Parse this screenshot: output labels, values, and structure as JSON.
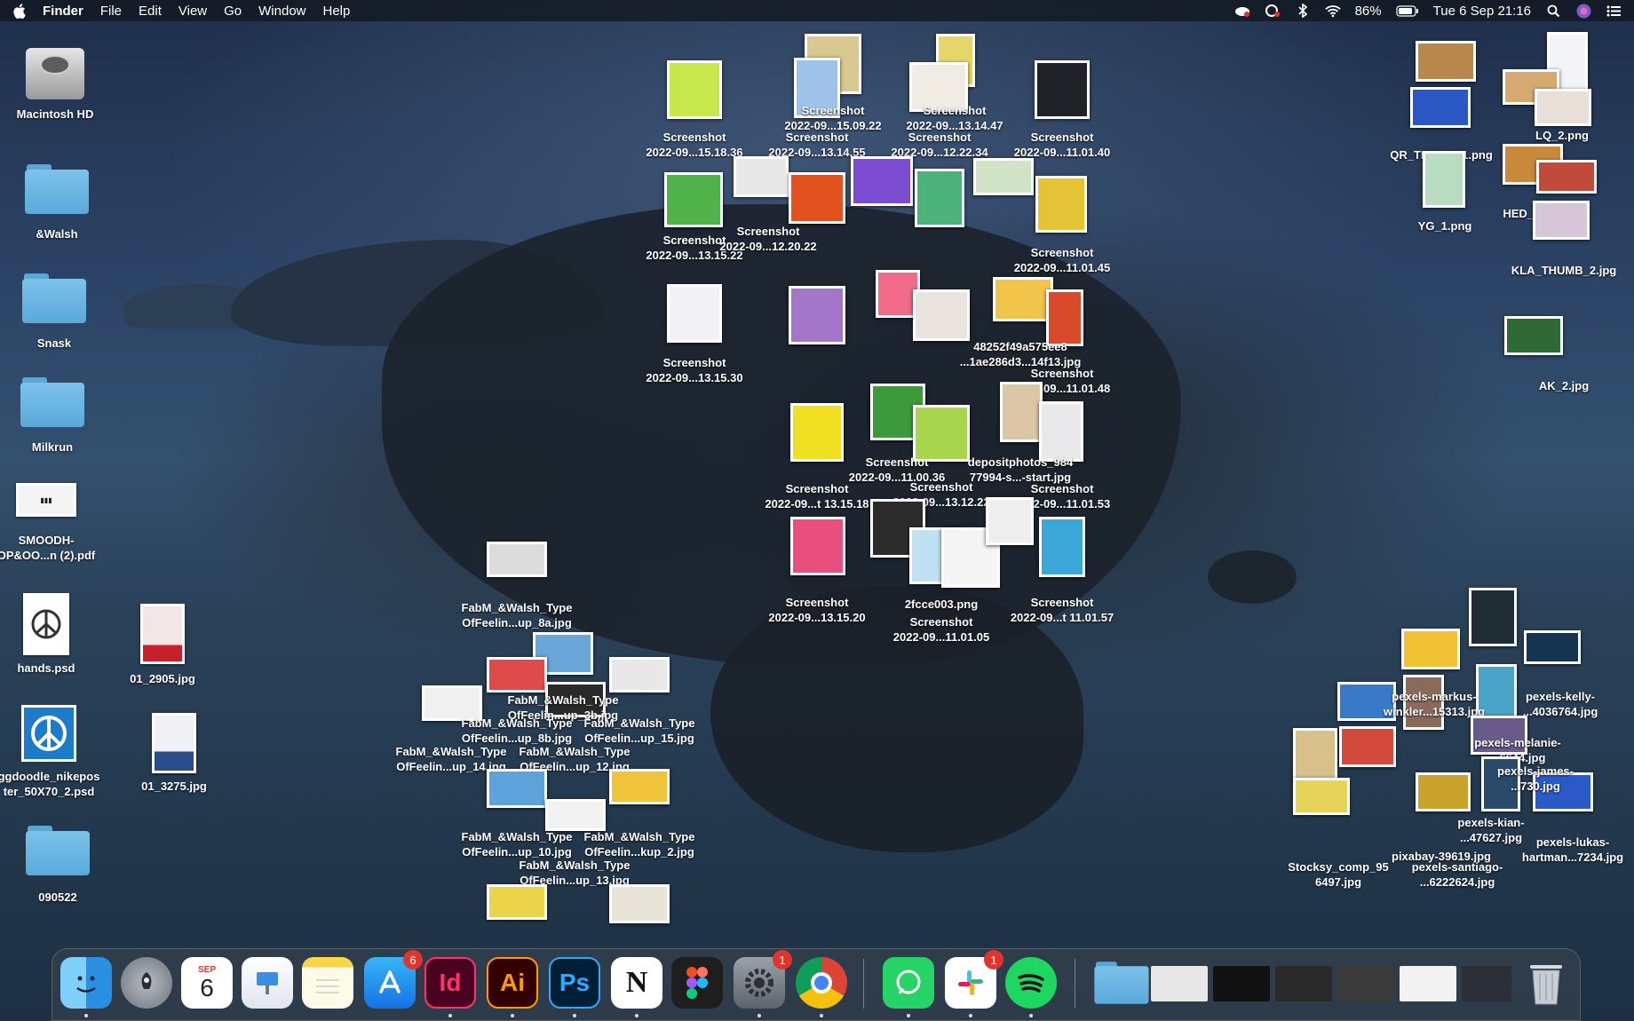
{
  "menubar": {
    "app": "Finder",
    "items": [
      "File",
      "Edit",
      "View",
      "Go",
      "Window",
      "Help"
    ],
    "battery": "86%",
    "datetime": "Tue 6 Sep  21:16"
  },
  "desktop_left": [
    {
      "label": "Macintosh HD"
    },
    {
      "label": "&Walsh"
    },
    {
      "label": "Snask"
    },
    {
      "label": "Milkrun"
    },
    {
      "label": "SMOODH-\nOP&OO...n (2).pdf"
    },
    {
      "label": "hands.psd"
    },
    {
      "label": "01_2905.jpg"
    },
    {
      "label": "ggdoodle_nikepos\nter_50X70_2.psd"
    },
    {
      "label": "01_3275.jpg"
    },
    {
      "label": "090522"
    }
  ],
  "screenshots": [
    {
      "label": "Screenshot\n2022-09...15.18.36"
    },
    {
      "label": "Screenshot\n2022-09...15.09.22"
    },
    {
      "label": "Screenshot\n2022-09...13.14.55"
    },
    {
      "label": "Screenshot\n2022-09...13.14.47"
    },
    {
      "label": "Screenshot\n2022-09...12.22.34"
    },
    {
      "label": "Screenshot\n2022-09...11.01.40"
    },
    {
      "label": "Screenshot\n2022-09...13.15.22"
    },
    {
      "label": "Screenshot\n2022-09...12.20.22"
    },
    {
      "label": "Screenshot\n2022-09...11.01.45"
    },
    {
      "label": "Screenshot\n2022-09...13.15.30"
    },
    {
      "label": "Screenshot\n2022-09...11.01.48"
    },
    {
      "label": "48252f49a575ee8\n...1ae286d3...14f13.jpg"
    },
    {
      "label": "Screenshot\n2022-09...t 13.15.18"
    },
    {
      "label": "Screenshot\n2022-09...11.00.36"
    },
    {
      "label": "Screenshot\n2022-09...13.12.22"
    },
    {
      "label": "depositphotos_984\n77994-s...-start.jpg"
    },
    {
      "label": "Screenshot\n2022-09...11.01.53"
    },
    {
      "label": "Screenshot\n2022-09...13.15.20"
    },
    {
      "label": "2fcce003.png"
    },
    {
      "label": "Screenshot\n2022-09...11.01.05"
    },
    {
      "label": "Screenshot\n2022-09...t 11.01.57"
    }
  ],
  "fabm": [
    {
      "label": "FabM_&Walsh_Type\nOfFeelin...up_8a.jpg"
    },
    {
      "label": "FabM_&Walsh_Type\nOfFeelin...up_3b.jpg"
    },
    {
      "label": "FabM_&Walsh_Type\nOfFeelin...up_8b.jpg"
    },
    {
      "label": "FabM_&Walsh_Type\nOfFeelin...up_15.jpg"
    },
    {
      "label": "FabM_&Walsh_Type\nOfFeelin...up_14.jpg"
    },
    {
      "label": "FabM_&Walsh_Type\nOfFeelin...up_12.jpg"
    },
    {
      "label": "FabM_&Walsh_Type\nOfFeelin...up_10.jpg"
    },
    {
      "label": "FabM_&Walsh_Type\nOfFeelin...kup_2.jpg"
    },
    {
      "label": "FabM_&Walsh_Type\nOfFeelin...up_13.jpg"
    }
  ],
  "right_top": [
    {
      "label": "LQ_2.png"
    },
    {
      "label": "QR_THUMB_1.png"
    },
    {
      "label": "YG_1.png"
    },
    {
      "label": "HED_1.png"
    },
    {
      "label": "KLA_THUMB_2.jpg"
    },
    {
      "label": "AK_2.jpg"
    }
  ],
  "right_bottom": [
    {
      "label": "pexels-kelly-\n...4036764.jpg"
    },
    {
      "label": "pexels-markus-\nwinkler...15313.jpg"
    },
    {
      "label": "pexels-melanie-\n...6644.jpg"
    },
    {
      "label": "pexels-james-\n...730.jpg"
    },
    {
      "label": "pexels-kian-\n...47627.jpg"
    },
    {
      "label": "pexels-lukas-\nhartman...7234.jpg"
    },
    {
      "label": "pixabay-39619.jpg"
    },
    {
      "label": "Stocksy_comp_95\n6497.jpg"
    },
    {
      "label": "pexels-santiago-\n...6222624.jpg"
    }
  ],
  "dock": {
    "apps": [
      {
        "name": "Finder"
      },
      {
        "name": "Launchpad"
      },
      {
        "name": "Calendar",
        "month": "SEP",
        "day": "6"
      },
      {
        "name": "Keynote"
      },
      {
        "name": "Notes"
      },
      {
        "name": "App Store",
        "badge": "6"
      },
      {
        "name": "InDesign",
        "text": "Id"
      },
      {
        "name": "Illustrator",
        "text": "Ai"
      },
      {
        "name": "Photoshop",
        "text": "Ps"
      },
      {
        "name": "Notion",
        "text": "N"
      },
      {
        "name": "Figma"
      },
      {
        "name": "System Preferences",
        "badge": "1"
      },
      {
        "name": "Chrome"
      },
      {
        "name": "WhatsApp"
      },
      {
        "name": "Slack",
        "badge": "1"
      },
      {
        "name": "Spotify"
      },
      {
        "name": "Downloads"
      },
      {
        "name": "Trash"
      }
    ]
  },
  "colors": {
    "menubar": "#121822",
    "folder": "#6fb8e6",
    "badge": "#e0352f"
  }
}
